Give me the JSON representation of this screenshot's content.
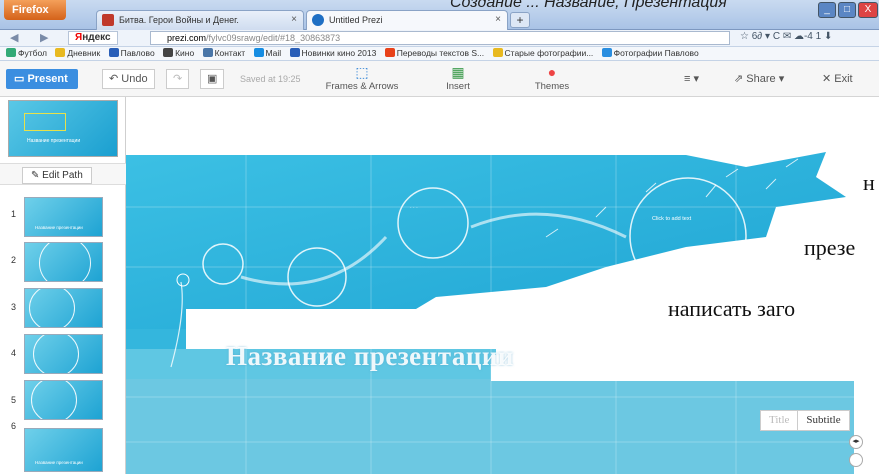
{
  "browser": {
    "menu_button": "Firefox",
    "tabs": [
      {
        "label": "Битва. Герои Войны и Денег.",
        "favicon_color": "#c0392b"
      },
      {
        "label": "Untitled Prezi",
        "favicon_color": "#1f6fc4"
      }
    ],
    "new_tab": "+",
    "overlay_text": "Создание ... Название, Презентация",
    "window_controls": [
      "_",
      "□",
      "X"
    ],
    "nav": {
      "back": "◀",
      "forward": "▶",
      "yandex_first": "Я",
      "yandex_rest": "ндекс",
      "url_host": "prezi.com",
      "url_path": "/fylvc09srawg/edit/#18_30863873",
      "right_icons": "☆ 6∂ ▾ C   ✉ ☁-4  1  ⬇"
    },
    "bookmarks": [
      {
        "label": "Футбол",
        "color": "#3a7"
      },
      {
        "label": "Дневник",
        "color": "#e8b920"
      },
      {
        "label": "Павлово",
        "color": "#2a5fb8"
      },
      {
        "label": "Кино",
        "color": "#444"
      },
      {
        "label": "Контакт",
        "color": "#4a76a8"
      },
      {
        "label": "Mail",
        "color": "#168de2"
      },
      {
        "label": "Новинки кино 2013",
        "color": "#2a5fb8"
      },
      {
        "label": "Переводы текстов S...",
        "color": "#e8421a"
      },
      {
        "label": "Старые фотографии...",
        "color": "#e8b920"
      },
      {
        "label": "Фотографии Павлово",
        "color": "#2a8ee0"
      }
    ]
  },
  "prezi_toolbar": {
    "present": "Present",
    "undo": "Undo",
    "saved": "Saved at 19:25",
    "frames_arrows": "Frames & Arrows",
    "insert": "Insert",
    "themes": "Themes",
    "menu": "≡ ▾",
    "share": "Share ▾",
    "exit": "Exit"
  },
  "left_panel": {
    "overview_caption": "Название презентации",
    "edit_path": "Edit Path",
    "slides": [
      {
        "number": "1",
        "caption": "Название презентации"
      },
      {
        "number": "2",
        "caption": ""
      },
      {
        "number": "3",
        "caption": ""
      },
      {
        "number": "4",
        "caption": ""
      },
      {
        "number": "5",
        "caption": ""
      },
      {
        "number": "6",
        "caption": "Название презентации"
      }
    ]
  },
  "canvas": {
    "text_lines": [
      "н",
      "презе",
      "написать заго"
    ],
    "title": "Название презентации",
    "frame_labels": [
      "Click to add text"
    ],
    "title_switch": {
      "off": "Title",
      "on": "Subtitle"
    },
    "zoom_control": "◂▸"
  },
  "colors": {
    "present_blue": "#3b8ee0",
    "canvas_cyan": "#2fb0d8"
  }
}
